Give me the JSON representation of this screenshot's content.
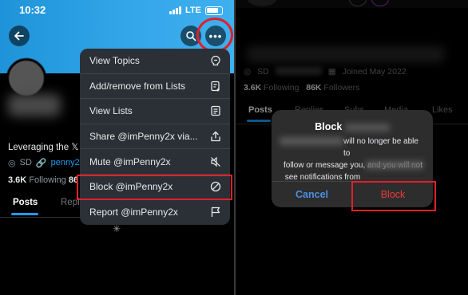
{
  "status_bar": {
    "time": "10:32",
    "network": "LTE"
  },
  "colors": {
    "banner": "#2a9fe4",
    "accent": "#1d9bf0",
    "highlight": "#e0202a",
    "destructive": "#ef3b36",
    "cancel": "#4a90e2",
    "menu_bg": "#2b3036",
    "dialog_bg": "#2d2d2e"
  },
  "left_profile": {
    "bio": "Leveraging the 𝕏 n",
    "location": "SD",
    "link": "penny2x.",
    "following_count": "3.6K",
    "following_label": "Following",
    "followers_partial": "86",
    "tabs": [
      "Posts",
      "Repl"
    ]
  },
  "menu": {
    "items": [
      {
        "label": "View Topics",
        "icon": "topics-icon"
      },
      {
        "label": "Add/remove from Lists",
        "icon": "list-add-icon"
      },
      {
        "label": "View Lists",
        "icon": "lists-icon"
      },
      {
        "label": "Share @imPenny2x via...",
        "icon": "share-icon"
      },
      {
        "label": "Mute @imPenny2x",
        "icon": "mute-icon"
      },
      {
        "label": "Block @imPenny2x",
        "icon": "block-icon"
      },
      {
        "label": "Report @imPenny2x",
        "icon": "flag-icon"
      }
    ]
  },
  "right_profile": {
    "location": "SD",
    "joined": "Joined May 2022",
    "following_count": "3.6K",
    "following_label": "Following",
    "followers_count": "86K",
    "followers_label": "Followers",
    "tabs": [
      "Posts",
      "Replies",
      "Subs",
      "Media",
      "Likes"
    ]
  },
  "dialog": {
    "title": "Block",
    "body_line1": "will no longer be able to",
    "body_line2": "follow or message you, and you will not",
    "body_line3": "see notifications from",
    "cancel_label": "Cancel",
    "block_label": "Block"
  }
}
